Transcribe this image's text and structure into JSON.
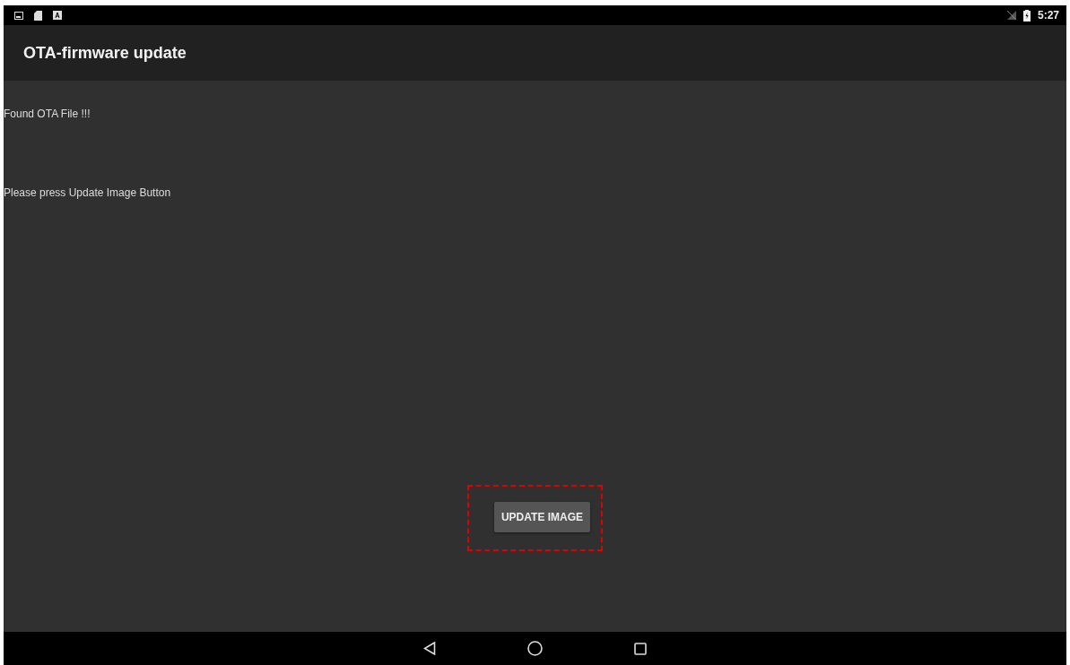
{
  "status_bar": {
    "time": "5:27"
  },
  "app_bar": {
    "title": "OTA-firmware update"
  },
  "messages": [
    "Found OTA File !!!",
    "Please press Update Image Button"
  ],
  "button": {
    "label": "UPDATE IMAGE",
    "highlighted": true
  }
}
